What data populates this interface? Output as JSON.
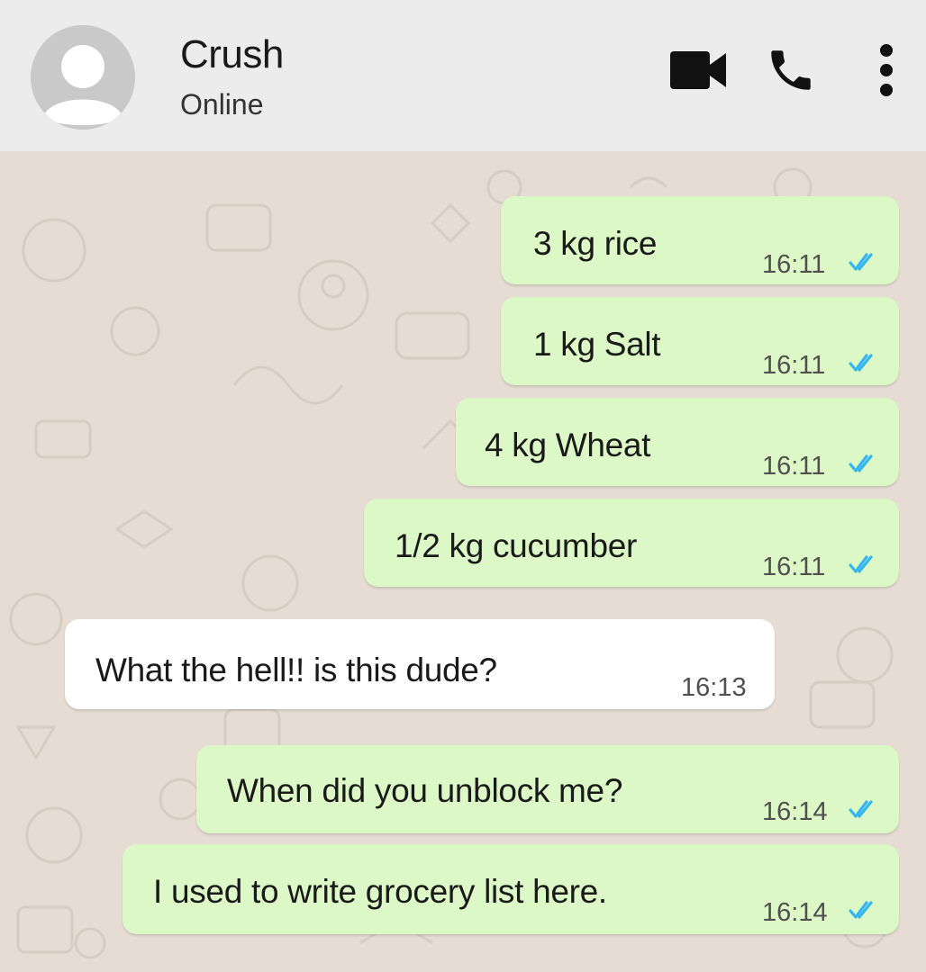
{
  "header": {
    "contact_name": "Crush",
    "status": "Online",
    "icons": {
      "avatar": "default-avatar-icon",
      "video": "video-camera-icon",
      "call": "phone-icon",
      "menu": "more-vertical-icon"
    }
  },
  "colors": {
    "header_bg": "#ececec",
    "chat_bg": "#e6dcd3",
    "outgoing_bubble": "#dcf8c6",
    "incoming_bubble": "#ffffff",
    "read_ticks": "#34b7f1"
  },
  "messages": [
    {
      "direction": "out",
      "text": "3 kg rice",
      "time": "16:11",
      "status": "read"
    },
    {
      "direction": "out",
      "text": "1 kg Salt",
      "time": "16:11",
      "status": "read"
    },
    {
      "direction": "out",
      "text": "4 kg Wheat",
      "time": "16:11",
      "status": "read"
    },
    {
      "direction": "out",
      "text": "1/2 kg cucumber",
      "time": "16:11",
      "status": "read"
    },
    {
      "direction": "in",
      "text": "What the hell!! is this dude?",
      "time": "16:13"
    },
    {
      "direction": "out",
      "text": "When did you unblock me?",
      "time": "16:14",
      "status": "read"
    },
    {
      "direction": "out",
      "text": "I used to write grocery list here.",
      "time": "16:14",
      "status": "read"
    }
  ]
}
